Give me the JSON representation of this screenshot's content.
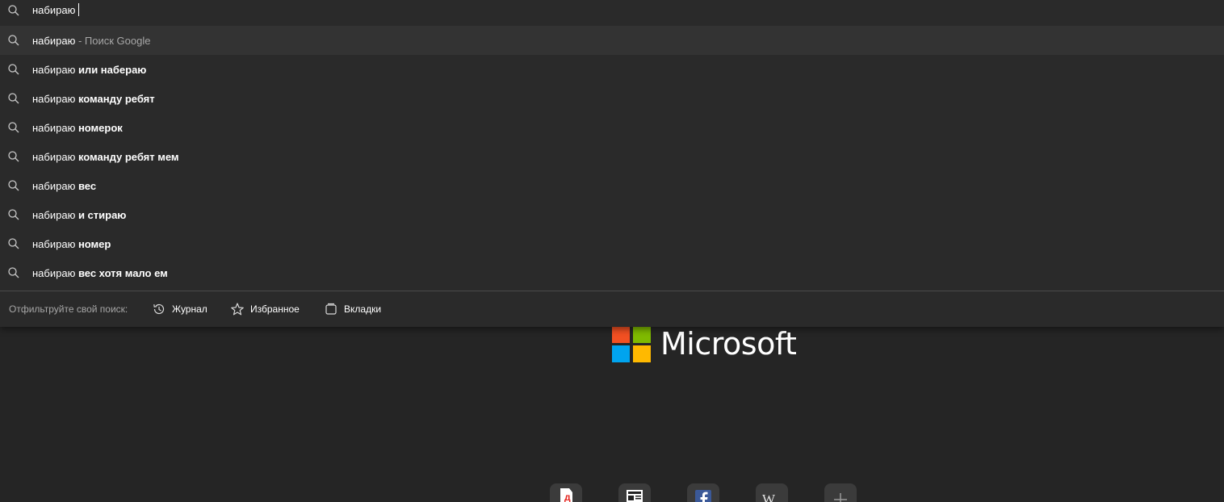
{
  "search": {
    "query": "набираю"
  },
  "suggestions": [
    {
      "prefix": "набираю",
      "bold": "",
      "muted": " - Поиск Google",
      "selected": true
    },
    {
      "prefix": "набираю",
      "bold": " или набераю",
      "muted": "",
      "selected": false
    },
    {
      "prefix": "набираю",
      "bold": " команду ребят",
      "muted": "",
      "selected": false
    },
    {
      "prefix": "набираю",
      "bold": " номерок",
      "muted": "",
      "selected": false
    },
    {
      "prefix": "набираю",
      "bold": " команду ребят мем",
      "muted": "",
      "selected": false
    },
    {
      "prefix": "набираю",
      "bold": " вес",
      "muted": "",
      "selected": false
    },
    {
      "prefix": "набираю",
      "bold": " и стираю",
      "muted": "",
      "selected": false
    },
    {
      "prefix": "набираю",
      "bold": " номер",
      "muted": "",
      "selected": false
    },
    {
      "prefix": "набираю",
      "bold": " вес хотя мало ем",
      "muted": "",
      "selected": false
    }
  ],
  "filter": {
    "label": "Отфильтруйте свой поиск:",
    "history": "Журнал",
    "favorites": "Избранное",
    "tabs": "Вкладки"
  },
  "brand": {
    "name": "Microsoft",
    "colors": {
      "red": "#f25022",
      "green": "#7fba00",
      "blue": "#00a4ef",
      "yellow": "#ffb900"
    }
  },
  "quick_links": [
    {
      "icon": "yandex-icon"
    },
    {
      "icon": "news-icon"
    },
    {
      "icon": "facebook-icon"
    },
    {
      "icon": "wikipedia-icon"
    },
    {
      "icon": "add-icon"
    }
  ],
  "colors": {
    "background": "#252525",
    "dropdown": "#2a2a2a",
    "selected_row": "#333333",
    "muted_text": "#a7a7a7"
  }
}
